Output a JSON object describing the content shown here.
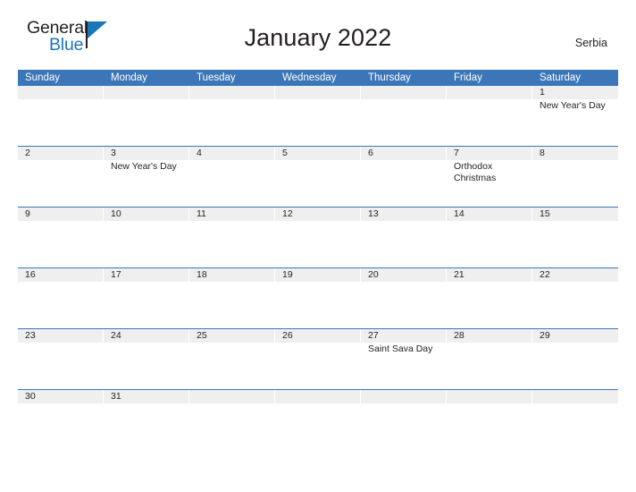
{
  "brand": {
    "name_part1": "General",
    "name_part2": "Blue",
    "triangle_color": "#1b75bb"
  },
  "header": {
    "title": "January 2022",
    "country": "Serbia"
  },
  "theme": {
    "header_blue": "#3b76b9",
    "band_gray": "#efeff0",
    "text_dark": "#231f20",
    "page_background": "#ffffff"
  },
  "calendar": {
    "month": "January",
    "year": "2022",
    "weekday_headers": [
      "Sunday",
      "Monday",
      "Tuesday",
      "Wednesday",
      "Thursday",
      "Friday",
      "Saturday"
    ],
    "weeks": [
      {
        "days": [
          {
            "num": "",
            "events": []
          },
          {
            "num": "",
            "events": []
          },
          {
            "num": "",
            "events": []
          },
          {
            "num": "",
            "events": []
          },
          {
            "num": "",
            "events": []
          },
          {
            "num": "",
            "events": []
          },
          {
            "num": "1",
            "events": [
              "New Year's Day"
            ]
          }
        ]
      },
      {
        "days": [
          {
            "num": "2",
            "events": []
          },
          {
            "num": "3",
            "events": [
              "New Year's Day"
            ]
          },
          {
            "num": "4",
            "events": []
          },
          {
            "num": "5",
            "events": []
          },
          {
            "num": "6",
            "events": []
          },
          {
            "num": "7",
            "events": [
              "Orthodox",
              "Christmas"
            ]
          },
          {
            "num": "8",
            "events": []
          }
        ]
      },
      {
        "days": [
          {
            "num": "9",
            "events": []
          },
          {
            "num": "10",
            "events": []
          },
          {
            "num": "11",
            "events": []
          },
          {
            "num": "12",
            "events": []
          },
          {
            "num": "13",
            "events": []
          },
          {
            "num": "14",
            "events": []
          },
          {
            "num": "15",
            "events": []
          }
        ]
      },
      {
        "days": [
          {
            "num": "16",
            "events": []
          },
          {
            "num": "17",
            "events": []
          },
          {
            "num": "18",
            "events": []
          },
          {
            "num": "19",
            "events": []
          },
          {
            "num": "20",
            "events": []
          },
          {
            "num": "21",
            "events": []
          },
          {
            "num": "22",
            "events": []
          }
        ]
      },
      {
        "days": [
          {
            "num": "23",
            "events": []
          },
          {
            "num": "24",
            "events": []
          },
          {
            "num": "25",
            "events": []
          },
          {
            "num": "26",
            "events": []
          },
          {
            "num": "27",
            "events": [
              "Saint Sava Day"
            ]
          },
          {
            "num": "28",
            "events": []
          },
          {
            "num": "29",
            "events": []
          }
        ]
      },
      {
        "days": [
          {
            "num": "30",
            "events": []
          },
          {
            "num": "31",
            "events": []
          },
          {
            "num": "",
            "events": []
          },
          {
            "num": "",
            "events": []
          },
          {
            "num": "",
            "events": []
          },
          {
            "num": "",
            "events": []
          },
          {
            "num": "",
            "events": []
          }
        ]
      }
    ]
  }
}
